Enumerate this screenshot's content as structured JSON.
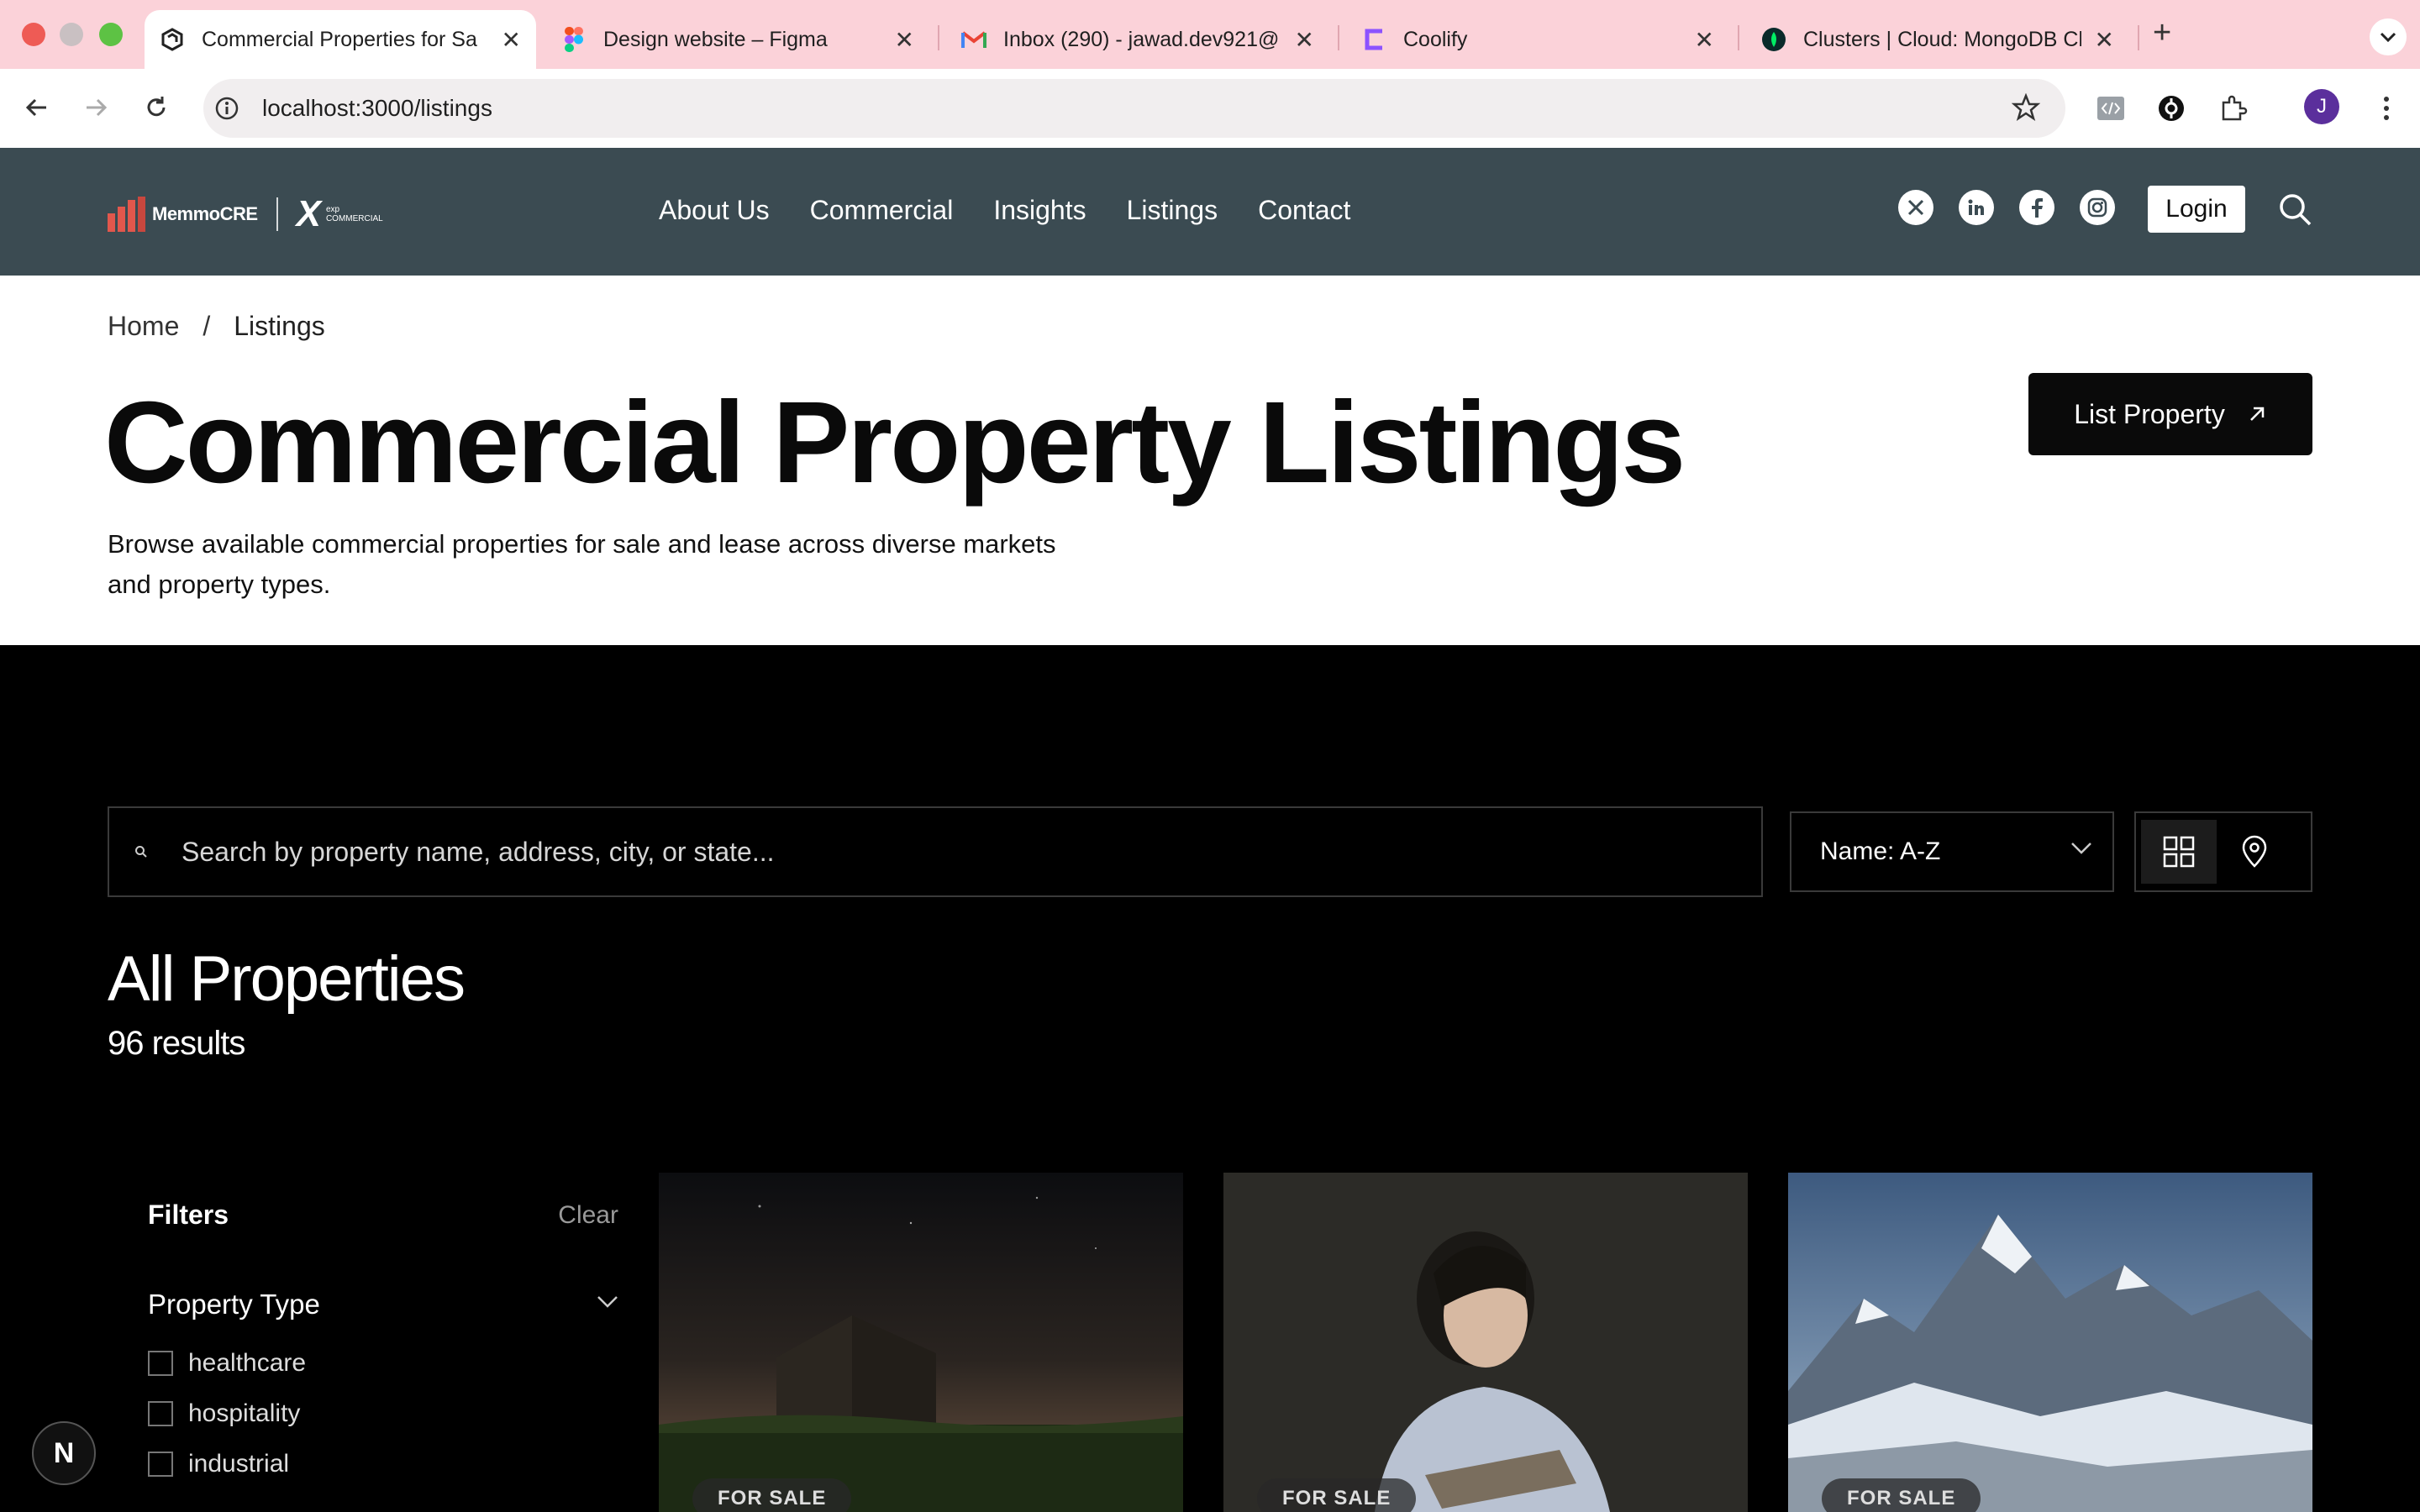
{
  "browser": {
    "tabs": [
      {
        "title": "Commercial Properties for Sa",
        "favicon": "site-icon"
      },
      {
        "title": "Design website – Figma",
        "favicon": "figma-icon"
      },
      {
        "title": "Inbox (290) - jawad.dev921@",
        "favicon": "gmail-icon"
      },
      {
        "title": "Coolify",
        "favicon": "coolify-icon"
      },
      {
        "title": "Clusters | Cloud: MongoDB Cl",
        "favicon": "mongodb-icon"
      }
    ],
    "url": "localhost:3000/listings",
    "profile_initial": "J"
  },
  "site": {
    "logo": {
      "brand": "MemmoCRE",
      "partner_top": "exp",
      "partner_bottom": "COMMERCIAL"
    },
    "nav": [
      "About Us",
      "Commercial",
      "Insights",
      "Listings",
      "Contact"
    ],
    "login_label": "Login"
  },
  "hero": {
    "breadcrumb": {
      "home": "Home",
      "sep": "/",
      "current": "Listings"
    },
    "title": "Commercial Property Listings",
    "subtitle": "Browse available commercial properties for sale and lease across diverse markets and property types.",
    "cta_label": "List Property"
  },
  "listings": {
    "search_placeholder": "Search by property name, address, city, or state...",
    "sort_value": "Name: A-Z",
    "section_title": "All Properties",
    "result_count": "96 results",
    "filters": {
      "title": "Filters",
      "clear_label": "Clear",
      "group_title": "Property Type",
      "options": [
        "healthcare",
        "hospitality",
        "industrial"
      ]
    },
    "cards": [
      {
        "badge": "FOR SALE"
      },
      {
        "badge": "FOR SALE"
      },
      {
        "badge": "FOR SALE"
      }
    ]
  },
  "dev_badge": "N"
}
